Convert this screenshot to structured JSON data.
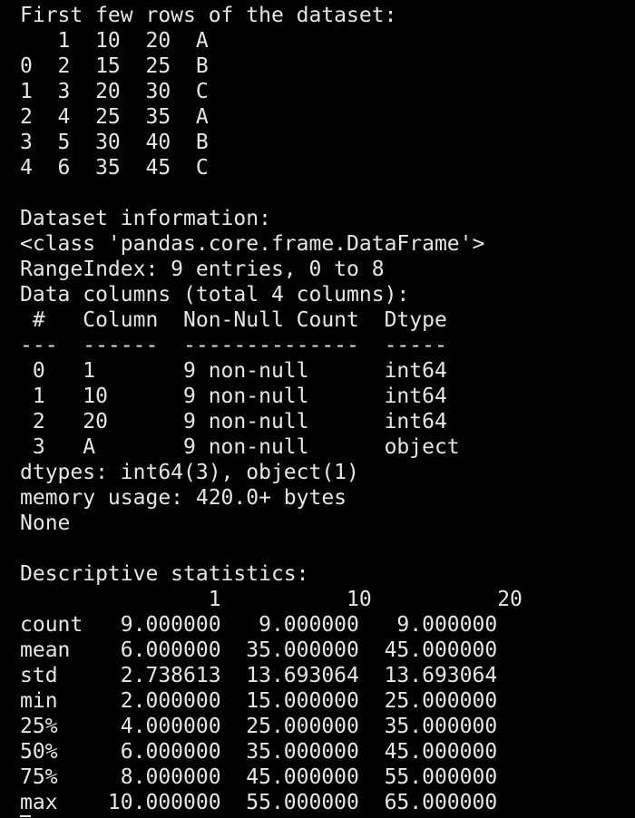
{
  "terminal": {
    "lines": [
      "First few rows of the dataset:",
      "   1  10  20  A",
      "0  2  15  25  B",
      "1  3  20  30  C",
      "2  4  25  35  A",
      "3  5  30  40  B",
      "4  6  35  45  C",
      "",
      "Dataset information:",
      "<class 'pandas.core.frame.DataFrame'>",
      "RangeIndex: 9 entries, 0 to 8",
      "Data columns (total 4 columns):",
      " #   Column  Non-Null Count  Dtype",
      "---  ------  --------------  -----",
      " 0   1       9 non-null      int64",
      " 1   10      9 non-null      int64",
      " 2   20      9 non-null      int64",
      " 3   A       9 non-null      object",
      "dtypes: int64(3), object(1)",
      "memory usage: 420.0+ bytes",
      "None",
      "",
      "Descriptive statistics:",
      "               1          10          20",
      "count   9.000000   9.000000   9.000000",
      "mean    6.000000  35.000000  45.000000",
      "std     2.738613  13.693064  13.693064",
      "min     2.000000  15.000000  25.000000",
      "25%     4.000000  25.000000  35.000000",
      "50%     6.000000  35.000000  45.000000",
      "75%     8.000000  45.000000  55.000000",
      "max    10.000000  55.000000  65.000000"
    ]
  }
}
